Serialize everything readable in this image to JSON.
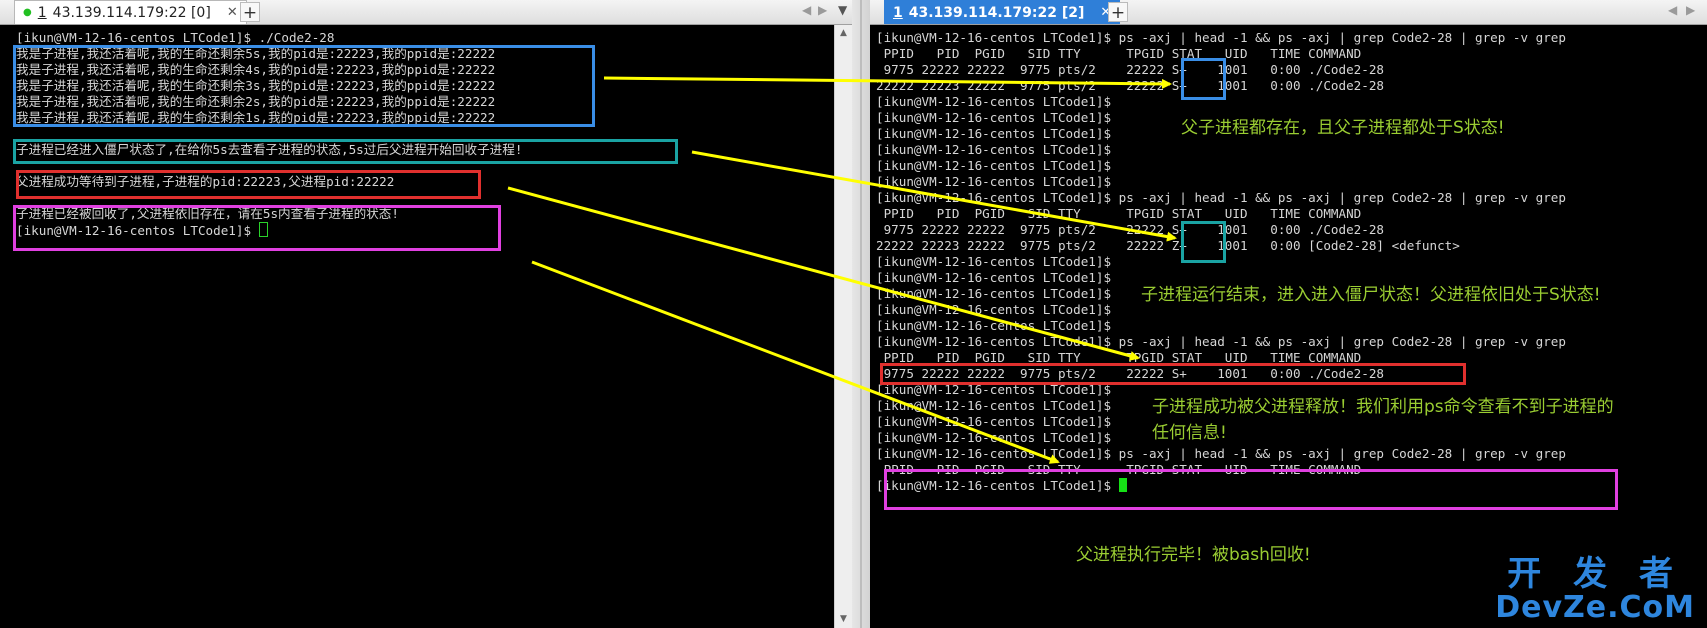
{
  "left_session": {
    "tab_index": "1",
    "tab_title": "43.139.114.179:22 [0]",
    "lines": [
      "[ikun@VM-12-16-centos LTCode1]$ ./Code2-28",
      "我是子进程,我还活着呢,我的生命还剩余5s,我的pid是:22223,我的ppid是:22222",
      "我是子进程,我还活着呢,我的生命还剩余4s,我的pid是:22223,我的ppid是:22222",
      "我是子进程,我还活着呢,我的生命还剩余3s,我的pid是:22223,我的ppid是:22222",
      "我是子进程,我还活着呢,我的生命还剩余2s,我的pid是:22223,我的ppid是:22222",
      "我是子进程,我还活着呢,我的生命还剩余1s,我的pid是:22223,我的ppid是:22222",
      "",
      "子进程已经进入僵尸状态了,在给你5s去查看子进程的状态,5s过后父进程开始回收子进程!",
      "",
      "父进程成功等待到子进程,子进程的pid:22223,父进程pid:22222",
      "",
      "子进程已经被回收了,父进程依旧存在，请在5s内查看子进程的状态!",
      "[ikun@VM-12-16-centos LTCode1]$ "
    ]
  },
  "right_session": {
    "tab_index": "1",
    "tab_title": "43.139.114.179:22 [2]",
    "lines": [
      "[ikun@VM-12-16-centos LTCode1]$ ps -axj | head -1 && ps -axj | grep Code2-28 | grep -v grep",
      " PPID   PID  PGID   SID TTY      TPGID STAT   UID   TIME COMMAND",
      " 9775 22222 22222  9775 pts/2    22222 S+    1001   0:00 ./Code2-28",
      "22222 22223 22222  9775 pts/2    22222 S+    1001   0:00 ./Code2-28",
      "[ikun@VM-12-16-centos LTCode1]$",
      "[ikun@VM-12-16-centos LTCode1]$",
      "[ikun@VM-12-16-centos LTCode1]$",
      "[ikun@VM-12-16-centos LTCode1]$",
      "[ikun@VM-12-16-centos LTCode1]$",
      "[ikun@VM-12-16-centos LTCode1]$",
      "[ikun@VM-12-16-centos LTCode1]$ ps -axj | head -1 && ps -axj | grep Code2-28 | grep -v grep",
      " PPID   PID  PGID   SID TTY      TPGID STAT   UID   TIME COMMAND",
      " 9775 22222 22222  9775 pts/2    22222 S+    1001   0:00 ./Code2-28",
      "22222 22223 22222  9775 pts/2    22222 Z+    1001   0:00 [Code2-28] <defunct>",
      "[ikun@VM-12-16-centos LTCode1]$",
      "[ikun@VM-12-16-centos LTCode1]$",
      "[ikun@VM-12-16-centos LTCode1]$",
      "[ikun@VM-12-16-centos LTCode1]$",
      "[ikun@VM-12-16-centos LTCode1]$",
      "[ikun@VM-12-16-centos LTCode1]$ ps -axj | head -1 && ps -axj | grep Code2-28 | grep -v grep",
      " PPID   PID  PGID   SID TTY      TPGID STAT   UID   TIME COMMAND",
      " 9775 22222 22222  9775 pts/2    22222 S+    1001   0:00 ./Code2-28",
      "[ikun@VM-12-16-centos LTCode1]$",
      "[ikun@VM-12-16-centos LTCode1]$",
      "[ikun@VM-12-16-centos LTCode1]$",
      "[ikun@VM-12-16-centos LTCode1]$",
      "[ikun@VM-12-16-centos LTCode1]$ ps -axj | head -1 && ps -axj | grep Code2-28 | grep -v grep",
      " PPID   PID  PGID   SID TTY      TPGID STAT   UID   TIME COMMAND",
      "[ikun@VM-12-16-centos LTCode1]$ "
    ]
  },
  "annotations": {
    "both_sleeping": "父子进程都存在，且父子进程都处于S状态!",
    "child_zombie": "子进程运行结束，进入进入僵尸状态！父进程依旧处于S状态!",
    "child_released_line1": "子进程成功被父进程释放！我们利用ps命令查看不到子进程的",
    "child_released_line2": "任何信息!",
    "parent_done": "父进程执行完毕！被bash回收!"
  },
  "watermark": {
    "line1": "开 发 者",
    "line2": "DevZe.CoM"
  },
  "colors": {
    "highlight_blue": "#3a8ee6",
    "highlight_teal": "#1aa3a3",
    "highlight_red": "#e0302e",
    "highlight_magenta": "#e040e0",
    "arrow_yellow": "#ffff00",
    "annotation_green": "#9acd32",
    "cursor_green": "#16e016"
  }
}
